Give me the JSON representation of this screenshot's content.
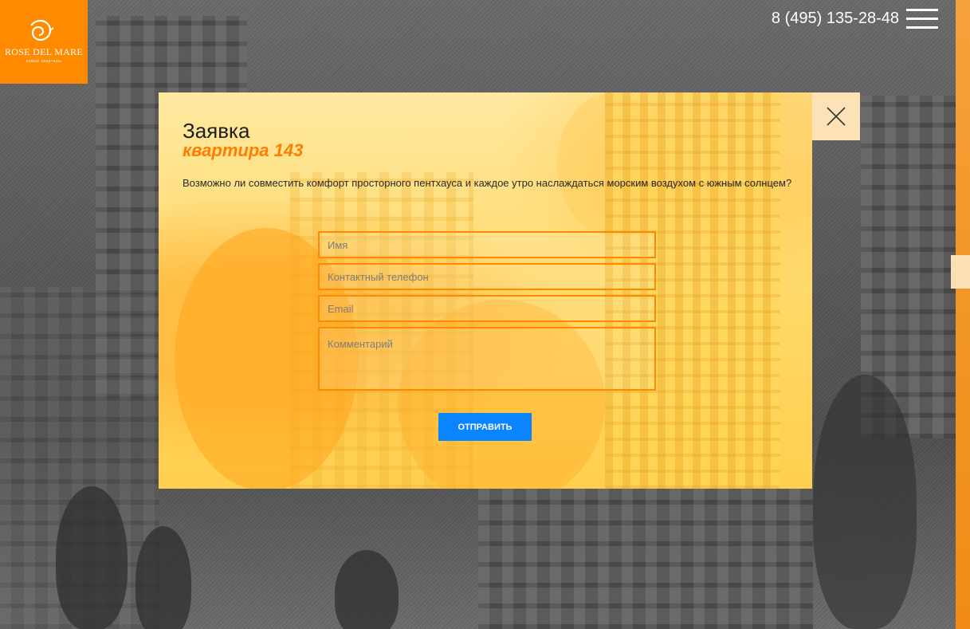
{
  "logo": {
    "name": "ROSE DEL MARE",
    "tagline": "новые квартиры"
  },
  "header": {
    "phone": "8 (495) 135-28-48",
    "menu_icon": "hamburger-icon"
  },
  "modal": {
    "title": "Заявка",
    "subtitle": "квартира 143",
    "description": "Возможно ли совместить комфорт просторного пентхауса и каждое утро наслаждаться морским воздухом с южным солнцем?",
    "fields": {
      "name_placeholder": "Имя",
      "phone_placeholder": "Контактный телефон",
      "email_placeholder": "Email",
      "comment_placeholder": "Комментарий"
    },
    "submit_label": "ОТПРАВИТЬ",
    "close_icon": "close-icon"
  },
  "colors": {
    "brand_orange": "#ff8a00",
    "button_blue": "#0a84ff",
    "subtitle_orange": "#ff7d00"
  }
}
